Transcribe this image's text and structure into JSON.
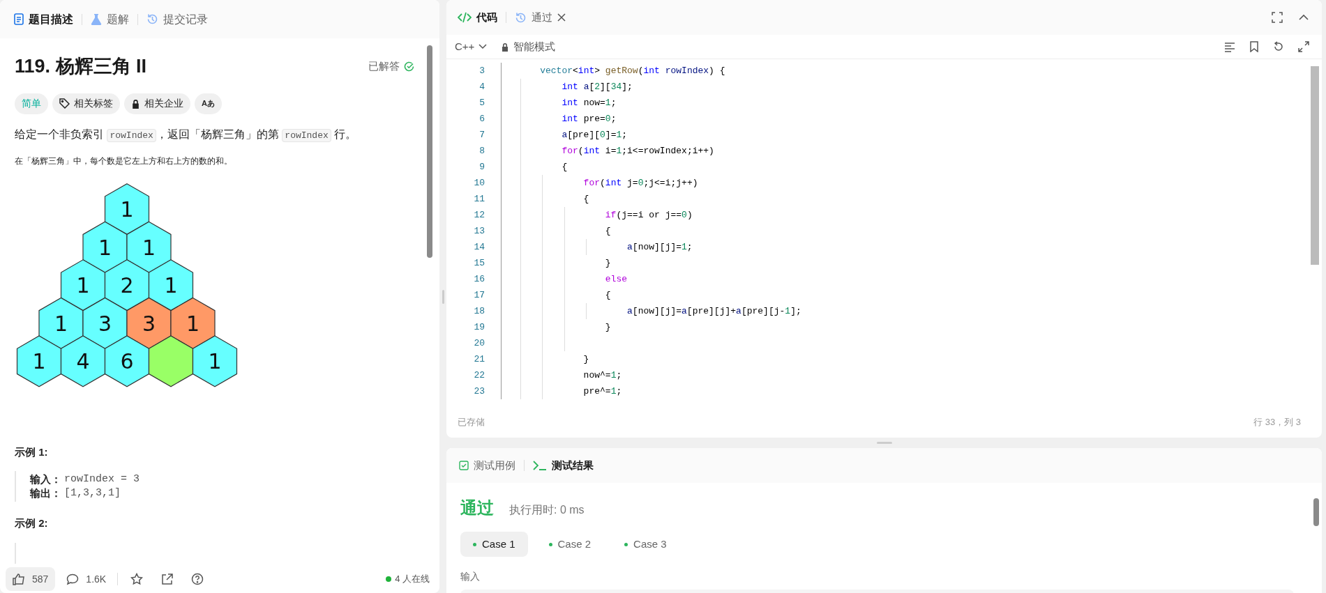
{
  "problem_panel": {
    "tabs": [
      {
        "label": "题目描述",
        "selected": true
      },
      {
        "label": "题解",
        "selected": false
      },
      {
        "label": "提交记录",
        "selected": false
      }
    ],
    "title": "119. 杨辉三角 II",
    "status": "已解答",
    "tags": [
      {
        "label": "简单",
        "kind": "difficulty"
      },
      {
        "label": "相关标签",
        "kind": "tag"
      },
      {
        "label": "相关企业",
        "kind": "lock"
      },
      {
        "label": "Aあ",
        "kind": "translate"
      }
    ],
    "description": [
      {
        "text": "给定一个非负索引 ",
        "kind": "text"
      },
      {
        "text": "rowIndex",
        "kind": "code"
      },
      {
        "text": "，返回「杨辉三角」的第 ",
        "kind": "text"
      },
      {
        "text": "rowIndex",
        "kind": "code"
      },
      {
        "text": " 行。",
        "kind": "text"
      }
    ],
    "note": "在「杨辉三角」中，每个数是它左上方和右上方的数的和。",
    "triangle": [
      [
        {
          "value": "1",
          "color": "#66ffff"
        }
      ],
      [
        {
          "value": "1",
          "color": "#66ffff"
        },
        {
          "value": "1",
          "color": "#66ffff"
        }
      ],
      [
        {
          "value": "1",
          "color": "#66ffff"
        },
        {
          "value": "2",
          "color": "#66ffff"
        },
        {
          "value": "1",
          "color": "#66ffff"
        }
      ],
      [
        {
          "value": "1",
          "color": "#66ffff"
        },
        {
          "value": "3",
          "color": "#66ffff"
        },
        {
          "value": "3",
          "color": "#ff9966"
        },
        {
          "value": "1",
          "color": "#ff9966"
        }
      ],
      [
        {
          "value": "1",
          "color": "#66ffff"
        },
        {
          "value": "4",
          "color": "#66ffff"
        },
        {
          "value": "6",
          "color": "#66ffff"
        },
        {
          "color": "#99ff66"
        },
        {
          "value": "1",
          "color": "#66ffff"
        }
      ]
    ],
    "examples": [
      {
        "title": "示例 1:",
        "lines": [
          {
            "label": "输入：",
            "value": "rowIndex = 3"
          },
          {
            "label": "输出：",
            "value": "[1,3,3,1]"
          }
        ]
      },
      {
        "title": "示例 2:"
      }
    ],
    "footer": {
      "likes": "587",
      "comments": "1.6K",
      "online": "4 人在线"
    }
  },
  "editor": {
    "tabs": [
      {
        "label": "代码",
        "selected": true,
        "closable": false
      },
      {
        "label": "通过",
        "selected": false,
        "closable": true
      }
    ],
    "language": "C++",
    "mode": "智能模式",
    "lines": [
      {
        "number": "3",
        "tokens": [
          {
            "text": "    vector",
            "kind": "type"
          },
          {
            "text": "<",
            "kind": "plain"
          },
          {
            "text": "int",
            "kind": "keyword"
          },
          {
            "text": "> ",
            "kind": "plain"
          },
          {
            "text": "getRow",
            "kind": "function"
          },
          {
            "text": "(",
            "kind": "plain"
          },
          {
            "text": "int",
            "kind": "keyword"
          },
          {
            "text": " rowIndex",
            "kind": "variable"
          },
          {
            "text": ") {",
            "kind": "plain"
          }
        ]
      },
      {
        "number": "4",
        "tokens": [
          {
            "text": "        int",
            "kind": "keyword"
          },
          {
            "text": " a",
            "kind": "variable"
          },
          {
            "text": "[",
            "kind": "plain"
          },
          {
            "text": "2",
            "kind": "number"
          },
          {
            "text": "][",
            "kind": "plain"
          },
          {
            "text": "34",
            "kind": "number"
          },
          {
            "text": "];",
            "kind": "plain"
          }
        ]
      },
      {
        "number": "5",
        "tokens": [
          {
            "text": "        int",
            "kind": "keyword"
          },
          {
            "text": " now=",
            "kind": "plain"
          },
          {
            "text": "1",
            "kind": "number"
          },
          {
            "text": ";",
            "kind": "plain"
          }
        ]
      },
      {
        "number": "6",
        "tokens": [
          {
            "text": "        int",
            "kind": "keyword"
          },
          {
            "text": " pre=",
            "kind": "plain"
          },
          {
            "text": "0",
            "kind": "number"
          },
          {
            "text": ";",
            "kind": "plain"
          }
        ]
      },
      {
        "number": "7",
        "tokens": [
          {
            "text": "        a",
            "kind": "variable"
          },
          {
            "text": "[pre][",
            "kind": "plain"
          },
          {
            "text": "0",
            "kind": "number"
          },
          {
            "text": "]=",
            "kind": "plain"
          },
          {
            "text": "1",
            "kind": "number"
          },
          {
            "text": ";",
            "kind": "plain"
          }
        ]
      },
      {
        "number": "8",
        "tokens": [
          {
            "text": "        for",
            "kind": "control"
          },
          {
            "text": "(",
            "kind": "plain"
          },
          {
            "text": "int",
            "kind": "keyword"
          },
          {
            "text": " i=",
            "kind": "plain"
          },
          {
            "text": "1",
            "kind": "number"
          },
          {
            "text": ";i<=rowIndex;i++)",
            "kind": "plain"
          }
        ]
      },
      {
        "number": "9",
        "tokens": [
          {
            "text": "        {",
            "kind": "plain"
          }
        ]
      },
      {
        "number": "10",
        "tokens": [
          {
            "text": "            for",
            "kind": "control"
          },
          {
            "text": "(",
            "kind": "plain"
          },
          {
            "text": "int",
            "kind": "keyword"
          },
          {
            "text": " j=",
            "kind": "plain"
          },
          {
            "text": "0",
            "kind": "number"
          },
          {
            "text": ";j<=i;j++)",
            "kind": "plain"
          }
        ]
      },
      {
        "number": "11",
        "tokens": [
          {
            "text": "            {",
            "kind": "plain"
          }
        ]
      },
      {
        "number": "12",
        "tokens": [
          {
            "text": "                if",
            "kind": "control"
          },
          {
            "text": "(j==i or j==",
            "kind": "plain"
          },
          {
            "text": "0",
            "kind": "number"
          },
          {
            "text": ")",
            "kind": "plain"
          }
        ]
      },
      {
        "number": "13",
        "tokens": [
          {
            "text": "                {",
            "kind": "plain"
          }
        ]
      },
      {
        "number": "14",
        "tokens": [
          {
            "text": "                    a",
            "kind": "variable"
          },
          {
            "text": "[now][j]=",
            "kind": "plain"
          },
          {
            "text": "1",
            "kind": "number"
          },
          {
            "text": ";",
            "kind": "plain"
          }
        ]
      },
      {
        "number": "15",
        "tokens": [
          {
            "text": "                }",
            "kind": "plain"
          }
        ]
      },
      {
        "number": "16",
        "tokens": [
          {
            "text": "                else",
            "kind": "control"
          }
        ]
      },
      {
        "number": "17",
        "tokens": [
          {
            "text": "                {",
            "kind": "plain"
          }
        ]
      },
      {
        "number": "18",
        "tokens": [
          {
            "text": "                    a",
            "kind": "variable"
          },
          {
            "text": "[now][j]=",
            "kind": "plain"
          },
          {
            "text": "a",
            "kind": "variable"
          },
          {
            "text": "[pre][j]+",
            "kind": "plain"
          },
          {
            "text": "a",
            "kind": "variable"
          },
          {
            "text": "[pre][j-",
            "kind": "plain"
          },
          {
            "text": "1",
            "kind": "number"
          },
          {
            "text": "];",
            "kind": "plain"
          }
        ]
      },
      {
        "number": "19",
        "tokens": [
          {
            "text": "                }",
            "kind": "plain"
          }
        ]
      },
      {
        "number": "20"
      },
      {
        "number": "21",
        "tokens": [
          {
            "text": "            }",
            "kind": "plain"
          }
        ]
      },
      {
        "number": "22",
        "tokens": [
          {
            "text": "            now^=",
            "kind": "plain"
          },
          {
            "text": "1",
            "kind": "number"
          },
          {
            "text": ";",
            "kind": "plain"
          }
        ]
      },
      {
        "number": "23",
        "tokens": [
          {
            "text": "            pre^=",
            "kind": "plain"
          },
          {
            "text": "1",
            "kind": "number"
          },
          {
            "text": ";",
            "kind": "plain"
          }
        ]
      }
    ],
    "saved": "已存储",
    "cursor": "行 33，列 3"
  },
  "test_panel": {
    "tabs": [
      {
        "label": "测试用例",
        "selected": false
      },
      {
        "label": "测试结果",
        "selected": true
      }
    ],
    "verdict": "通过",
    "runtime": "执行用时: 0 ms",
    "cases": [
      {
        "label": "Case 1",
        "selected": true
      },
      {
        "label": "Case 2",
        "selected": false
      },
      {
        "label": "Case 3",
        "selected": false
      }
    ],
    "input_label": "输入"
  }
}
